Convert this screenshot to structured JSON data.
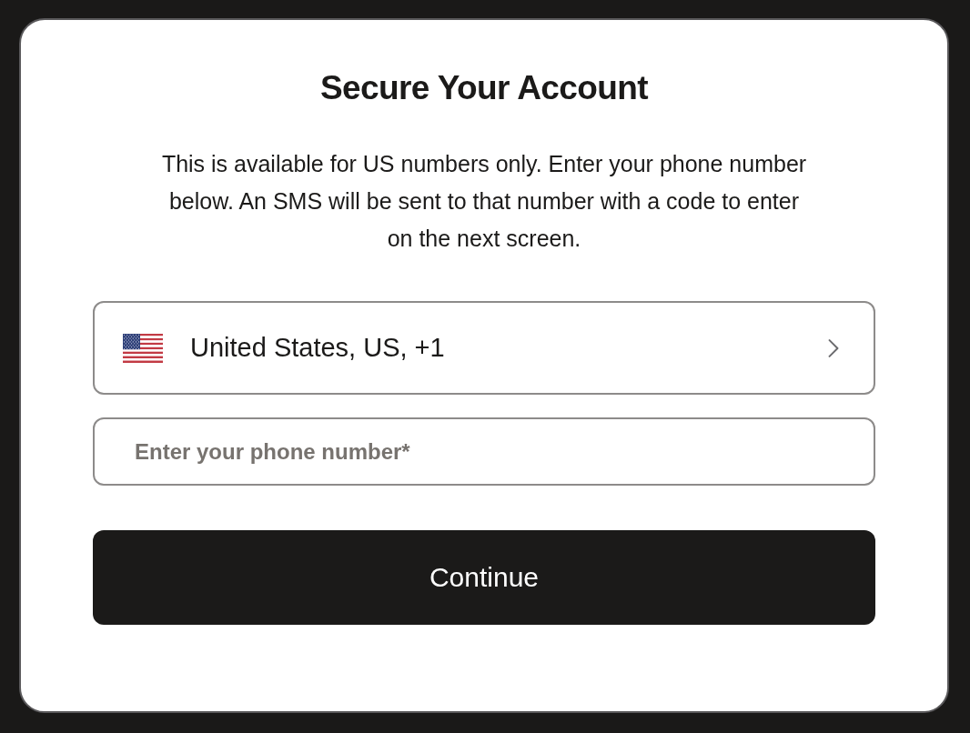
{
  "dialog": {
    "title": "Secure Your Account",
    "description": "This is available for US numbers only. Enter your phone number below. An SMS will be sent to that number with a code to enter on the next screen.",
    "country_select": {
      "label": "United States, US, +1"
    },
    "phone_field": {
      "placeholder": "Enter your phone number*"
    },
    "submit_button": {
      "label": "Continue"
    }
  }
}
